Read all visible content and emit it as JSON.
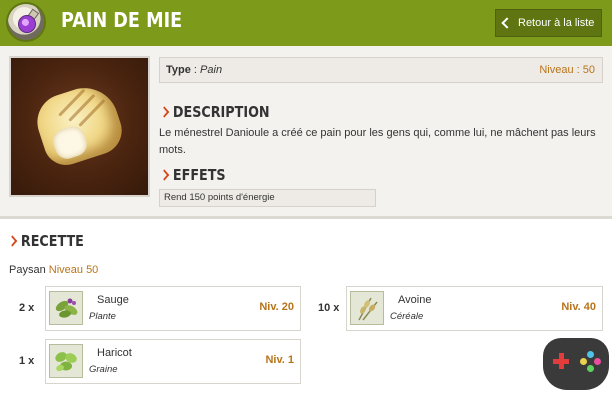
{
  "header": {
    "title": "PAIN DE MIE",
    "back_label": "Retour à la liste",
    "accent_color": "#7d9a1a",
    "icon": "potion-icon"
  },
  "item": {
    "image": "bread-loaf-image",
    "type_label": "Type",
    "type_value": "Pain",
    "level": "Niveau : 50"
  },
  "description": {
    "heading": "DESCRIPTION",
    "text": "Le ménestrel Danioule a créé ce pain pour les gens qui, comme lui, ne mâchent pas leurs mots."
  },
  "effects": {
    "heading": "EFFETS",
    "text": "Rend 150 points d'énergie"
  },
  "recipe": {
    "heading": "RECETTE",
    "profession": "Paysan",
    "profession_level": "Niveau 50",
    "ingredients": [
      {
        "qty": "2 x",
        "name": "Sauge",
        "type": "Plante",
        "level": "Niv. 20",
        "icon": "sage-plant-icon"
      },
      {
        "qty": "10 x",
        "name": "Avoine",
        "type": "Céréale",
        "level": "Niv. 40",
        "icon": "oat-cereal-icon"
      },
      {
        "qty": "1 x",
        "name": "Haricot",
        "type": "Graine",
        "level": "Niv. 1",
        "icon": "bean-seed-icon"
      }
    ]
  },
  "corner_icon": "gamepad-icon"
}
